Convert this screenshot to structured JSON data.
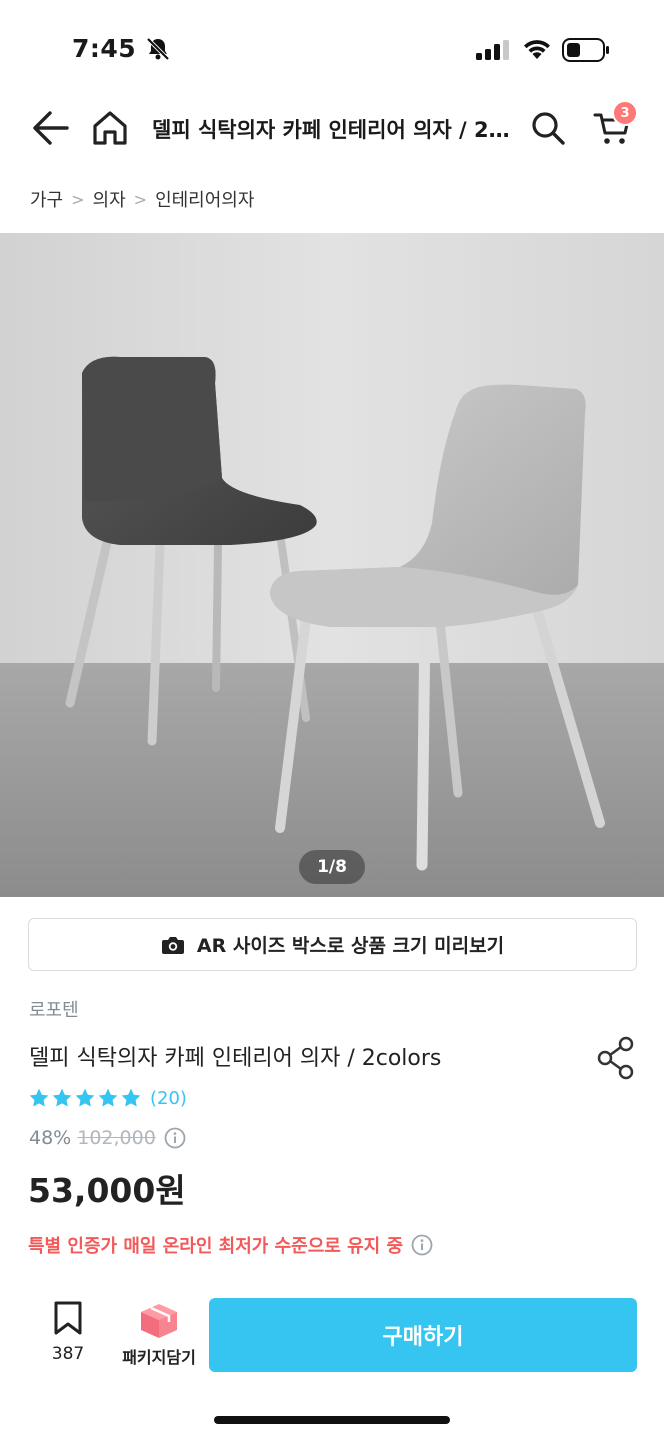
{
  "status": {
    "time": "7:45"
  },
  "nav": {
    "title": "델피 식탁의자 카페 인테리어 의자 / 2colors",
    "cart_count": "3"
  },
  "breadcrumb": [
    "가구",
    "의자",
    "인테리어의자"
  ],
  "gallery": {
    "counter": "1/8"
  },
  "ar": {
    "label": "AR 사이즈 박스로 상품 크기 미리보기"
  },
  "product": {
    "brand": "로포텐",
    "name": "델피 식탁의자 카페 인테리어 의자 / 2colors",
    "rating_stars": 5,
    "review_count": "(20)",
    "discount_rate": "48%",
    "original_price": "102,000",
    "price": "53,000원",
    "notice": "특별 인증가 매일 온라인 최저가 수준으로 유지 중"
  },
  "bottom": {
    "scrap_count": "387",
    "package_label": "패키지담기",
    "buy_label": "구매하기"
  },
  "colors": {
    "accent": "#35c5f0",
    "badge": "#ff7777",
    "notice": "#f25a5a"
  },
  "icons": [
    "bell-off-icon",
    "signal-icon",
    "wifi-icon",
    "battery-icon",
    "back-arrow-icon",
    "home-icon",
    "search-icon",
    "cart-icon",
    "camera-icon",
    "share-icon",
    "star-icon",
    "info-icon",
    "bookmark-icon",
    "package-box-icon"
  ]
}
